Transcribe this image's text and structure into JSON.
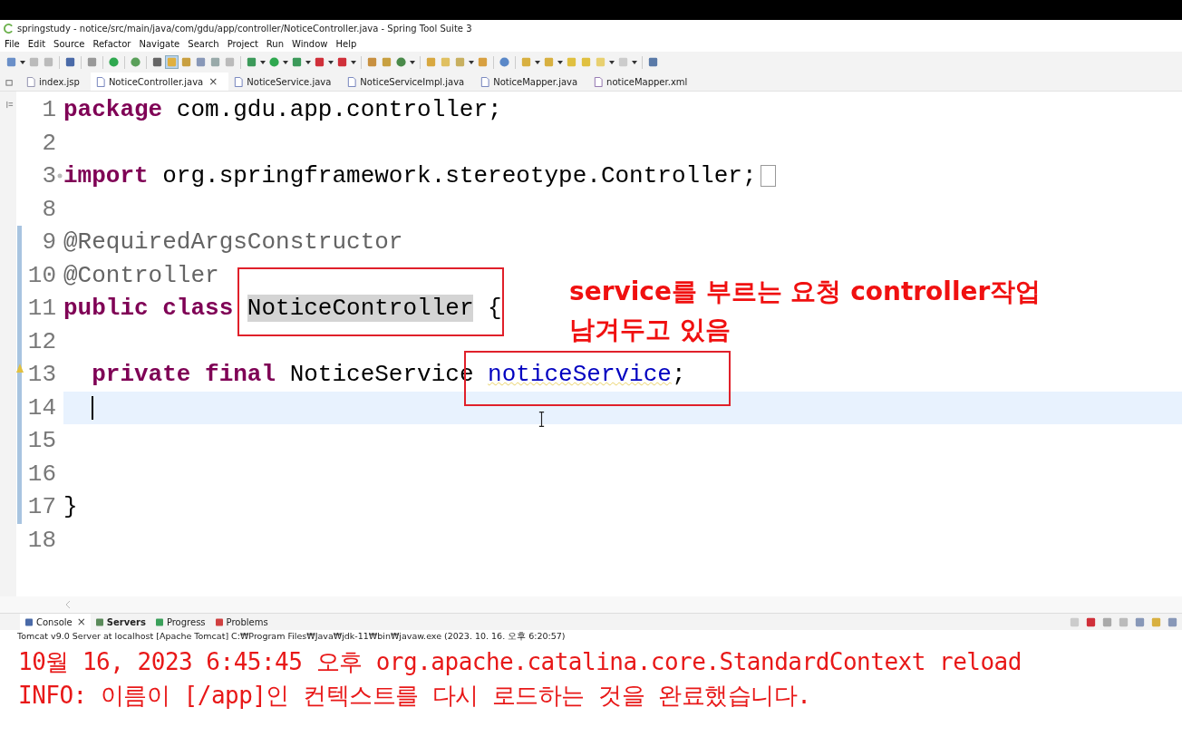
{
  "window": {
    "title": "springstudy - notice/src/main/java/com/gdu/app/controller/NoticeController.java - Spring Tool Suite 3"
  },
  "menu": [
    "File",
    "Edit",
    "Source",
    "Refactor",
    "Navigate",
    "Search",
    "Project",
    "Run",
    "Window",
    "Help"
  ],
  "editor_tabs": [
    {
      "label": "index.jsp",
      "kind": "jsp",
      "selected": false
    },
    {
      "label": "NoticeController.java",
      "kind": "java",
      "selected": true,
      "close": "×"
    },
    {
      "label": "NoticeService.java",
      "kind": "java",
      "selected": false
    },
    {
      "label": "NoticeServiceImpl.java",
      "kind": "java",
      "selected": false
    },
    {
      "label": "NoticeMapper.java",
      "kind": "java",
      "selected": false
    },
    {
      "label": "noticeMapper.xml",
      "kind": "xml",
      "selected": false
    }
  ],
  "code_lines": [
    {
      "number": "1",
      "changed": false,
      "current": false,
      "tokens": [
        {
          "text": "package",
          "kind": "keyword"
        },
        {
          "text": " com.gdu.app.controller;",
          "kind": "plain"
        }
      ]
    },
    {
      "number": "2",
      "changed": false,
      "current": false
    },
    {
      "number": "3",
      "changed": false,
      "current": false,
      "folded": true,
      "tokens": [
        {
          "text": "import",
          "kind": "keyword"
        },
        {
          "text": " org.springframework.stereotype.Controller;",
          "kind": "plain"
        }
      ]
    },
    {
      "number": "8",
      "changed": false,
      "current": false
    },
    {
      "number": "9",
      "changed": true,
      "current": false,
      "tokens": [
        {
          "text": "@RequiredArgsConstructor",
          "kind": "annotation"
        }
      ]
    },
    {
      "number": "10",
      "changed": true,
      "current": false,
      "tokens": [
        {
          "text": "@Controller",
          "kind": "annotation"
        }
      ]
    },
    {
      "number": "11",
      "changed": true,
      "current": false,
      "tokens": [
        {
          "text": "public",
          "kind": "keyword"
        },
        {
          "text": " class",
          "kind": "keyword"
        },
        {
          "text": "NoticeController",
          "kind": "highlight"
        },
        {
          "text": " {",
          "kind": "plain"
        }
      ]
    },
    {
      "number": "12",
      "changed": true,
      "current": false
    },
    {
      "number": "13",
      "changed": true,
      "current": false,
      "warning": true,
      "indent": true,
      "tokens": [
        {
          "text": "private",
          "kind": "keyword"
        },
        {
          "text": " final",
          "kind": "keyword"
        },
        {
          "text": " NoticeService",
          "kind": "plain"
        },
        {
          "text": "noticeService",
          "kind": "field"
        },
        {
          "text": ";",
          "kind": "plain"
        }
      ]
    },
    {
      "number": "14",
      "changed": true,
      "current": true,
      "indent": true
    },
    {
      "number": "15",
      "changed": true,
      "current": false
    },
    {
      "number": "16",
      "changed": true,
      "current": false
    },
    {
      "number": "17",
      "changed": true,
      "current": false,
      "tokens": [
        {
          "text": "}",
          "kind": "plain"
        }
      ]
    },
    {
      "number": "18",
      "changed": false,
      "current": false
    }
  ],
  "callout": [
    "service를 부르는 요청 controller작업",
    "남겨두고 있음"
  ],
  "console_tabs": [
    {
      "label": "Console",
      "kind": "console",
      "selected": true,
      "close": "×"
    },
    {
      "label": "Servers",
      "kind": "servers",
      "selected": false
    },
    {
      "label": "Progress",
      "kind": "progress",
      "selected": false
    },
    {
      "label": "Problems",
      "kind": "problems",
      "selected": false
    }
  ],
  "console_process": "Tomcat v9.0 Server at localhost [Apache Tomcat] C:₩Program Files₩Java₩jdk-11₩bin₩javaw.exe  (2023. 10. 16. 오후 6:20:57)",
  "console_output": [
    "10월 16, 2023 6:45:45 오후 org.apache.catalina.core.StandardContext reload",
    "INFO: 이름이 [/app]인 컨텍스트를 다시 로드하는 것을 완료했습니다."
  ]
}
